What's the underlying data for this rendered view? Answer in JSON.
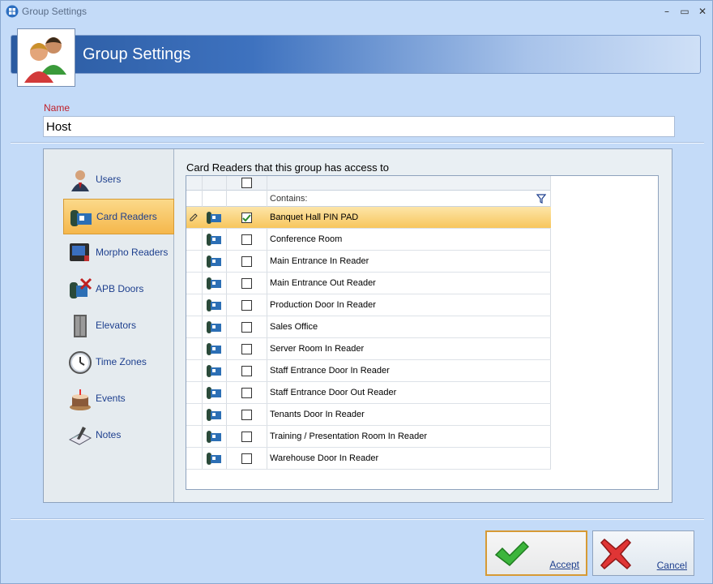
{
  "window": {
    "title": "Group Settings"
  },
  "banner": {
    "title": "Group Settings"
  },
  "name": {
    "label": "Name",
    "value": "Host"
  },
  "nav": {
    "items": [
      {
        "label": "Users",
        "icon": "user-icon"
      },
      {
        "label": "Card Readers",
        "icon": "card-reader-icon",
        "active": true
      },
      {
        "label": "Morpho Readers",
        "icon": "morpho-reader-icon"
      },
      {
        "label": "APB Doors",
        "icon": "apb-door-icon"
      },
      {
        "label": "Elevators",
        "icon": "elevator-icon"
      },
      {
        "label": "Time Zones",
        "icon": "clock-icon"
      },
      {
        "label": "Events",
        "icon": "cake-icon"
      },
      {
        "label": "Notes",
        "icon": "notes-icon"
      }
    ]
  },
  "content": {
    "title": "Card Readers that this group has access to",
    "filter_label": "Contains:",
    "rows": [
      {
        "name": "Banquet Hall PIN PAD",
        "checked": true,
        "selected": true
      },
      {
        "name": "Conference Room",
        "checked": false
      },
      {
        "name": "Main Entrance In Reader",
        "checked": false
      },
      {
        "name": "Main Entrance Out Reader",
        "checked": false
      },
      {
        "name": "Production Door In Reader",
        "checked": false
      },
      {
        "name": "Sales Office",
        "checked": false
      },
      {
        "name": "Server Room In Reader",
        "checked": false
      },
      {
        "name": "Staff Entrance Door In Reader",
        "checked": false
      },
      {
        "name": "Staff Entrance Door Out Reader",
        "checked": false
      },
      {
        "name": "Tenants Door In Reader",
        "checked": false
      },
      {
        "name": "Training / Presentation Room In Reader",
        "checked": false
      },
      {
        "name": "Warehouse Door In Reader",
        "checked": false
      }
    ]
  },
  "buttons": {
    "accept": "Accept",
    "cancel": "Cancel"
  },
  "colors": {
    "accent_orange": "#f5b74b",
    "link_blue": "#1d3f8e",
    "window_bg": "#c4dbf8"
  }
}
